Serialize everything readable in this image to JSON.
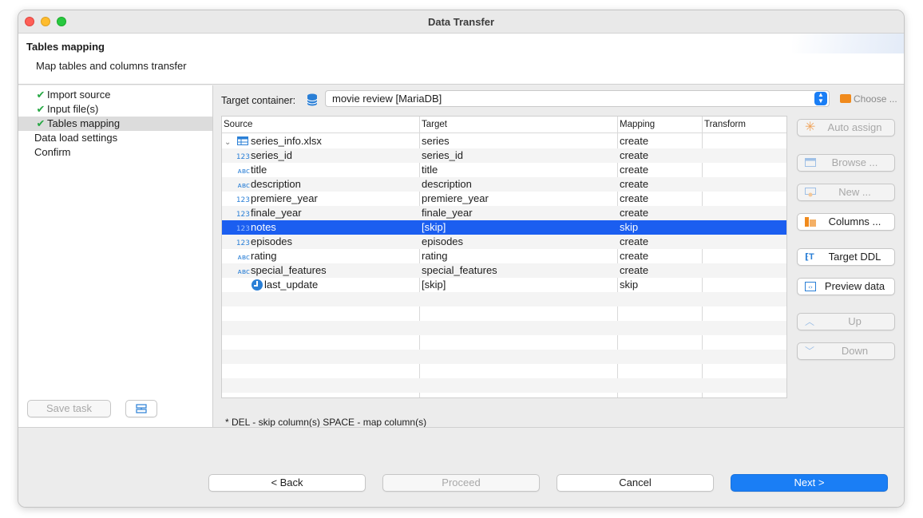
{
  "window": {
    "title": "Data Transfer"
  },
  "header": {
    "title": "Tables mapping",
    "subtitle": "Map tables and columns transfer"
  },
  "nav": {
    "items": [
      {
        "label": "Import source",
        "done": true
      },
      {
        "label": "Input file(s)",
        "done": true
      },
      {
        "label": "Tables mapping",
        "done": true
      },
      {
        "label": "Data load settings",
        "done": false
      },
      {
        "label": "Confirm",
        "done": false
      }
    ],
    "save_task_label": "Save task"
  },
  "target": {
    "label": "Target container:",
    "value": "movie review  [MariaDB]",
    "choose_label": "Choose ..."
  },
  "table": {
    "columns": [
      "Source",
      "Target",
      "Mapping",
      "Transform"
    ],
    "rows": [
      {
        "type": "table",
        "source": "series_info.xlsx",
        "target": "series",
        "mapping": "create"
      },
      {
        "type": "123",
        "source": "series_id",
        "target": "series_id",
        "mapping": "create"
      },
      {
        "type": "ABC",
        "source": "title",
        "target": "title",
        "mapping": "create"
      },
      {
        "type": "ABC",
        "source": "description",
        "target": "description",
        "mapping": "create"
      },
      {
        "type": "123",
        "source": "premiere_year",
        "target": "premiere_year",
        "mapping": "create"
      },
      {
        "type": "123",
        "source": "finale_year",
        "target": "finale_year",
        "mapping": "create"
      },
      {
        "type": "123",
        "source": "notes",
        "target": "[skip]",
        "mapping": "skip",
        "selected": true
      },
      {
        "type": "123",
        "source": "episodes",
        "target": "episodes",
        "mapping": "create"
      },
      {
        "type": "ABC",
        "source": "rating",
        "target": "rating",
        "mapping": "create"
      },
      {
        "type": "ABC",
        "source": "special_features",
        "target": "special_features",
        "mapping": "create"
      },
      {
        "type": "clock",
        "source": "last_update",
        "target": "[skip]",
        "mapping": "skip"
      }
    ],
    "footnote": "* DEL - skip column(s)  SPACE - map column(s)"
  },
  "side_buttons": [
    {
      "label": "Auto assign",
      "icon": "asterisk-icon",
      "enabled": false
    },
    {
      "label": "Browse ...",
      "icon": "table-browse-icon",
      "enabled": false
    },
    {
      "label": "New ...",
      "icon": "new-table-icon",
      "enabled": false
    },
    {
      "label": "Columns ...",
      "icon": "columns-icon",
      "enabled": true
    },
    {
      "label": "Target DDL",
      "icon": "ddl-icon",
      "enabled": true
    },
    {
      "label": "Preview data",
      "icon": "preview-icon",
      "enabled": true
    },
    {
      "label": "Up",
      "icon": "chevron-up-icon",
      "enabled": false
    },
    {
      "label": "Down",
      "icon": "chevron-down-icon",
      "enabled": false
    }
  ],
  "footer": {
    "back_label": "< Back",
    "proceed_label": "Proceed",
    "cancel_label": "Cancel",
    "next_label": "Next >"
  },
  "colors": {
    "accent": "#1a7ef5",
    "selection": "#1b5ef0",
    "check": "#27a844"
  }
}
